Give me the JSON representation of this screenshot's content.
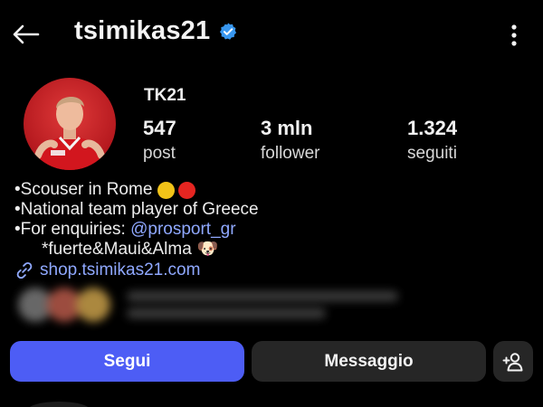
{
  "header": {
    "username": "tsimikas21",
    "verified": true
  },
  "profile": {
    "display_name": "TK21",
    "stats": {
      "posts": {
        "value": "547",
        "label": "post"
      },
      "followers": {
        "value": "3 mln",
        "label": "follower"
      },
      "following": {
        "value": "1.324",
        "label": "seguiti"
      }
    }
  },
  "bio": {
    "line1": "•Scouser in Rome",
    "line2": "•National team player of Greece",
    "line3_prefix": "•For enquiries: ",
    "line3_mention": "@prosport_gr",
    "line4": "*fuerte&Maui&Alma",
    "line4_emoji": "🐶"
  },
  "link": {
    "text": "shop.tsimikas21.com"
  },
  "actions": {
    "follow_label": "Segui",
    "message_label": "Messaggio"
  },
  "colors": {
    "accent": "#4d5df5",
    "link": "#8fa8ff",
    "verified": "#3897f0",
    "button_dark": "#262626",
    "background": "#000000"
  },
  "icons": {
    "back": "arrow-left-icon",
    "verified": "verified-badge-icon",
    "more": "more-vertical-icon",
    "link": "link-chain-icon",
    "add_user": "add-user-icon"
  }
}
